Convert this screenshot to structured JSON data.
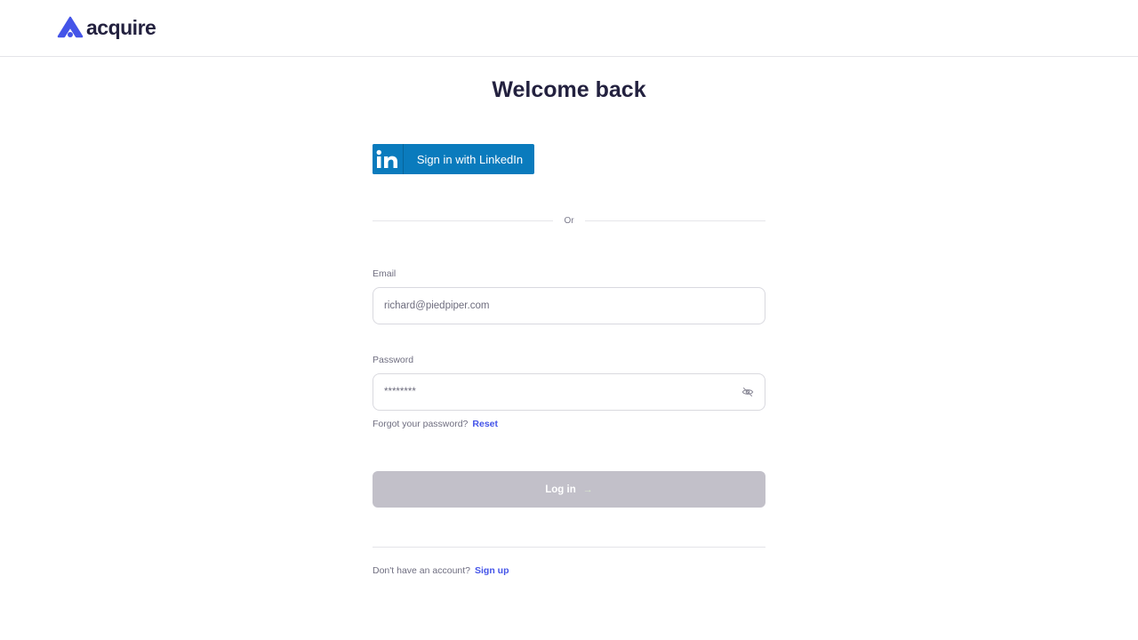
{
  "brand": {
    "name": "acquire",
    "colors": {
      "primary": "#4454e8",
      "dark": "#23213f",
      "linkedin": "#0a7bbd"
    }
  },
  "login": {
    "title": "Welcome back",
    "linkedin_label": "Sign in with LinkedIn",
    "divider_text": "Or",
    "email_label": "Email",
    "email_value": "richard@piedpiper.com",
    "password_label": "Password",
    "password_value": "********",
    "forgot_text": "Forgot your password?",
    "reset_link": "Reset",
    "login_button": "Log in",
    "login_arrow": "→",
    "signup_text": "Don't have an account?",
    "signup_link": "Sign up"
  },
  "icons": {
    "logo": "acquire-logo-icon",
    "linkedin": "linkedin-icon",
    "password_toggle": "eye-off-icon",
    "arrow": "arrow-right-icon"
  }
}
